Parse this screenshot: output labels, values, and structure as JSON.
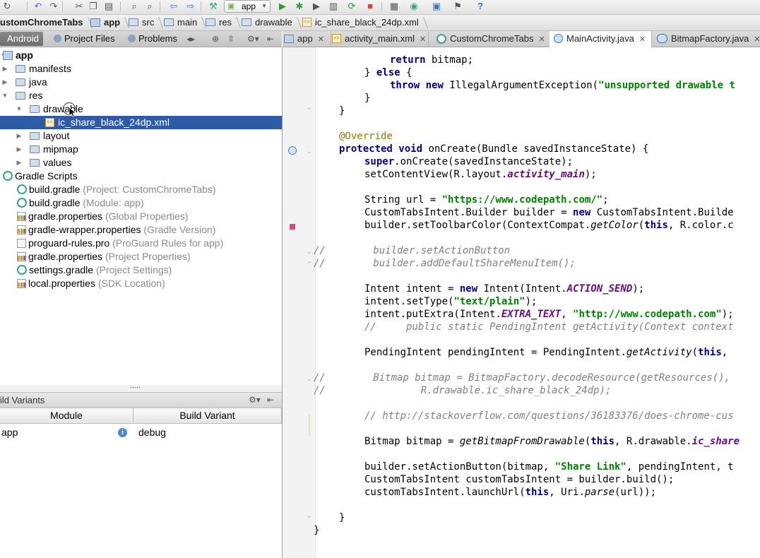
{
  "toolbar": {
    "run_config": "app",
    "icons": [
      "sync-icon",
      "undo-icon",
      "redo-icon",
      "cut-icon",
      "copy-icon",
      "paste-icon",
      "find-icon",
      "replace-icon",
      "back-icon",
      "forward-icon",
      "build-icon",
      "run-icon",
      "debug-icon",
      "profile-icon",
      "attach-icon",
      "rerun-icon",
      "stop-icon",
      "avd-icon",
      "sdk-icon",
      "structure-icon",
      "monitor-icon",
      "help-icon"
    ]
  },
  "breadcrumb": {
    "items": [
      "ustomChromeTabs",
      "app",
      "src",
      "main",
      "res",
      "drawable",
      "ic_share_black_24dp.xml"
    ]
  },
  "left_tabs": {
    "android": "Android",
    "project_files": "Project Files",
    "problems": "Problems"
  },
  "editor_tabs": [
    {
      "label": "app",
      "close": "✕"
    },
    {
      "label": "activity_main.xml",
      "close": "✕"
    },
    {
      "label": "CustomChromeTabs",
      "close": "✕"
    },
    {
      "label": "MainActivity.java",
      "close": "✕"
    },
    {
      "label": "BitmapFactory.java",
      "close": "✕"
    }
  ],
  "tree": {
    "app": "app",
    "manifests": "manifests",
    "java": "java",
    "res": "res",
    "drawable": "drawable",
    "selected_file": "ic_share_black_24dp.xml",
    "layout": "layout",
    "mipmap": "mipmap",
    "values": "values",
    "gradle_scripts": "Gradle Scripts",
    "files": [
      {
        "name": "build.gradle",
        "hint": "(Project: CustomChromeTabs)"
      },
      {
        "name": "build.gradle",
        "hint": "(Module: app)"
      },
      {
        "name": "gradle.properties",
        "hint": "(Global Properties)"
      },
      {
        "name": "gradle-wrapper.properties",
        "hint": "(Gradle Version)"
      },
      {
        "name": "proguard-rules.pro",
        "hint": "(ProGuard Rules for app)"
      },
      {
        "name": "gradle.properties",
        "hint": "(Project Properties)"
      },
      {
        "name": "settings.gradle",
        "hint": "(Project Settings)"
      },
      {
        "name": "local.properties",
        "hint": "(SDK Location)"
      }
    ]
  },
  "build_variants": {
    "title": "ild Variants",
    "col_module": "Module",
    "col_variant": "Build Variant",
    "row_module": "app",
    "row_variant": "debug"
  },
  "code": {
    "l1": [
      "return",
      " bitmap;"
    ],
    "l2": [
      "} ",
      "else",
      " {"
    ],
    "l3": [
      "throw",
      " ",
      "new",
      " IllegalArgumentException(",
      "\"unsupported drawable t"
    ],
    "l4": "}",
    "l5": "}",
    "l6": "@Override",
    "l7": [
      "protected",
      " ",
      "void",
      " onCreate(Bundle savedInstanceState) {"
    ],
    "l8": [
      "super",
      ".onCreate(savedInstanceState);"
    ],
    "l9": [
      "setContentView(R.layout.",
      "activity_main",
      ");"
    ],
    "l10": [
      "String url = ",
      "\"https://www.codepath.com/\"",
      ";"
    ],
    "l11": [
      "CustomTabsIntent.Builder builder = ",
      "new",
      " CustomTabsIntent.Builde"
    ],
    "l12": [
      "builder.setToolbarColor(ContextCompat.",
      "getColor",
      "(",
      "this",
      ", R.color.c"
    ],
    "l13": [
      "//",
      "        builder.setActionButton"
    ],
    "l14": [
      "//",
      "        builder.addDefaultShareMenuItem();"
    ],
    "l15": [
      "Intent intent = ",
      "new",
      " Intent(Intent.",
      "ACTION_SEND",
      ");"
    ],
    "l16": [
      "intent.setType(",
      "\"text/plain\"",
      ");"
    ],
    "l17": [
      "intent.putExtra(Intent.",
      "EXTRA_TEXT",
      ", ",
      "\"http://www.codepath.com\"",
      ");"
    ],
    "l18": "//     public static PendingIntent getActivity(Context context",
    "l19": [
      "PendingIntent pendingIntent = PendingIntent.",
      "getActivity",
      "(",
      "this",
      ","
    ],
    "l20": [
      "//",
      "        Bitmap bitmap = BitmapFactory.decodeResource(getResources(),"
    ],
    "l21": [
      "//",
      "                R.drawable.ic_share_black_24dp);"
    ],
    "l22": "// http://stackoverflow.com/questions/36183376/does-chrome-cus",
    "l23": [
      "Bitmap bitmap = ",
      "getBitmapFromDrawable",
      "(",
      "this",
      ", R.drawable.",
      "ic_share"
    ],
    "l24": [
      "builder.setActionButton(bitmap, ",
      "\"Share Link\"",
      ", pendingIntent, t"
    ],
    "l25": "CustomTabsIntent customTabsIntent = builder.build();",
    "l26": [
      "customTabsIntent.launchUrl(",
      "this",
      ", Uri.",
      "parse",
      "(url));"
    ],
    "l27": "}",
    "l28": "}"
  }
}
